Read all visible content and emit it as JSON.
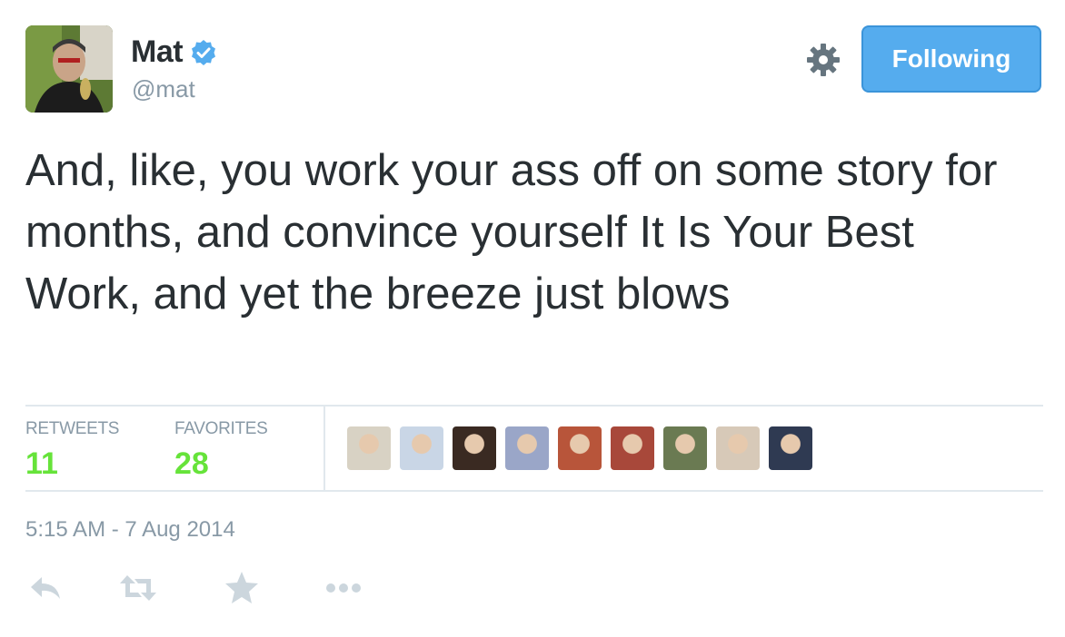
{
  "tweet": {
    "author_name": "Mat",
    "author_handle": "@mat",
    "verified": true,
    "follow_button_label": "Following",
    "text": "And, like, you work your ass off on some story for months, and convince yourself It Is Your Best Work, and yet the breeze just blows",
    "timestamp": "5:15 AM - 7 Aug 2014"
  },
  "stats": {
    "retweets_label": "RETWEETS",
    "retweets_count": "11",
    "favorites_label": "FAVORITES",
    "favorites_count": "28"
  },
  "favoriter_avatars": [
    {
      "name": "favoriter-avatar-1",
      "color": "#d8d2c4"
    },
    {
      "name": "favoriter-avatar-2",
      "color": "#c9d6e6"
    },
    {
      "name": "favoriter-avatar-3",
      "color": "#3a2a22"
    },
    {
      "name": "favoriter-avatar-4",
      "color": "#9aa6c8"
    },
    {
      "name": "favoriter-avatar-5",
      "color": "#b8553a"
    },
    {
      "name": "favoriter-avatar-6",
      "color": "#a8483a"
    },
    {
      "name": "favoriter-avatar-7",
      "color": "#6a7a52"
    },
    {
      "name": "favoriter-avatar-8",
      "color": "#d7c9b8"
    },
    {
      "name": "favoriter-avatar-9",
      "color": "#2f3a52"
    }
  ],
  "actions": {
    "icons": [
      "reply-icon",
      "retweet-icon",
      "favorite-icon",
      "more-icon"
    ],
    "color": "#ccd6dd"
  },
  "colors": {
    "accent": "#55acee",
    "stat_value": "#66e33a",
    "muted": "#8899a6",
    "text": "#292f33"
  }
}
